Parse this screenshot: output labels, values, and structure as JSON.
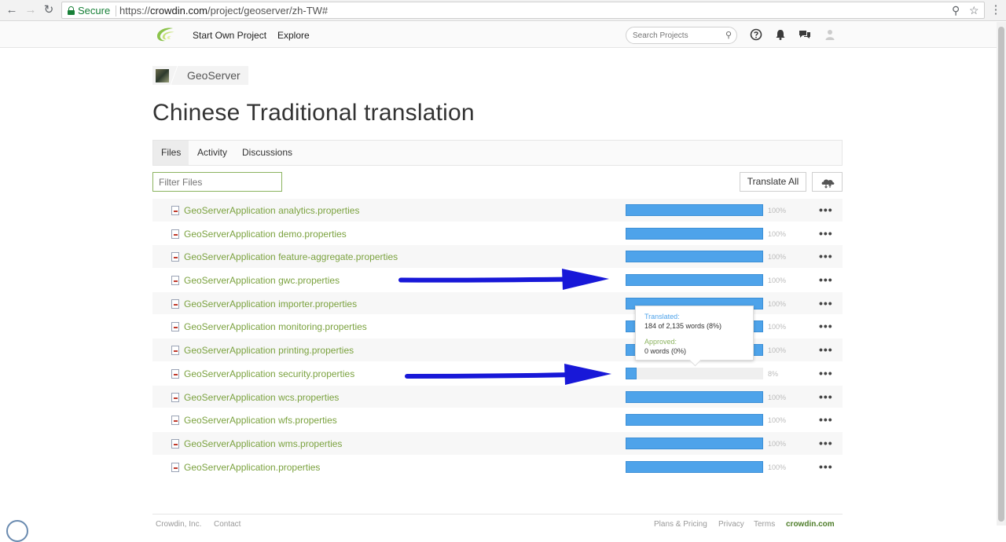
{
  "browser": {
    "secure_label": "Secure",
    "url_prefix": "https://",
    "url_domain": "crowdin.com",
    "url_path": "/project/geoserver/zh-TW#"
  },
  "header": {
    "nav": [
      "Start Own Project",
      "Explore"
    ],
    "search_placeholder": "Search Projects"
  },
  "breadcrumb": {
    "project": "GeoServer"
  },
  "page_title": "Chinese Traditional translation",
  "tabs": [
    {
      "label": "Files",
      "active": true
    },
    {
      "label": "Activity",
      "active": false
    },
    {
      "label": "Discussions",
      "active": false
    }
  ],
  "filter_placeholder": "Filter Files",
  "toolbar": {
    "translate_all": "Translate All"
  },
  "files": [
    {
      "name": "GeoServerApplication analytics.properties",
      "progress": 100,
      "pct": "100%"
    },
    {
      "name": "GeoServerApplication demo.properties",
      "progress": 100,
      "pct": "100%"
    },
    {
      "name": "GeoServerApplication feature-aggregate.properties",
      "progress": 100,
      "pct": "100%"
    },
    {
      "name": "GeoServerApplication gwc.properties",
      "progress": 100,
      "pct": "100%"
    },
    {
      "name": "GeoServerApplication importer.properties",
      "progress": 100,
      "pct": "100%"
    },
    {
      "name": "GeoServerApplication monitoring.properties",
      "progress": 100,
      "pct": "100%"
    },
    {
      "name": "GeoServerApplication printing.properties",
      "progress": 100,
      "pct": "100%"
    },
    {
      "name": "GeoServerApplication security.properties",
      "progress": 8,
      "pct": "8%"
    },
    {
      "name": "GeoServerApplication wcs.properties",
      "progress": 100,
      "pct": "100%"
    },
    {
      "name": "GeoServerApplication wfs.properties",
      "progress": 100,
      "pct": "100%"
    },
    {
      "name": "GeoServerApplication wms.properties",
      "progress": 100,
      "pct": "100%"
    },
    {
      "name": "GeoServerApplication.properties",
      "progress": 100,
      "pct": "100%"
    }
  ],
  "row_menu": "•••",
  "tooltip": {
    "translated_label": "Translated:",
    "translated_value": "184 of 2,135 words (8%)",
    "approved_label": "Approved:",
    "approved_value": "0 words (0%)"
  },
  "footer": {
    "left": [
      "Crowdin, Inc.",
      "Contact"
    ],
    "right": [
      "Plans & Pricing",
      "Privacy",
      "Terms"
    ],
    "brand": "crowdin.com"
  },
  "colors": {
    "accent_green": "#7ba23f",
    "bar_blue": "#4ea3ea",
    "arrow_blue": "#1a1ae0"
  }
}
